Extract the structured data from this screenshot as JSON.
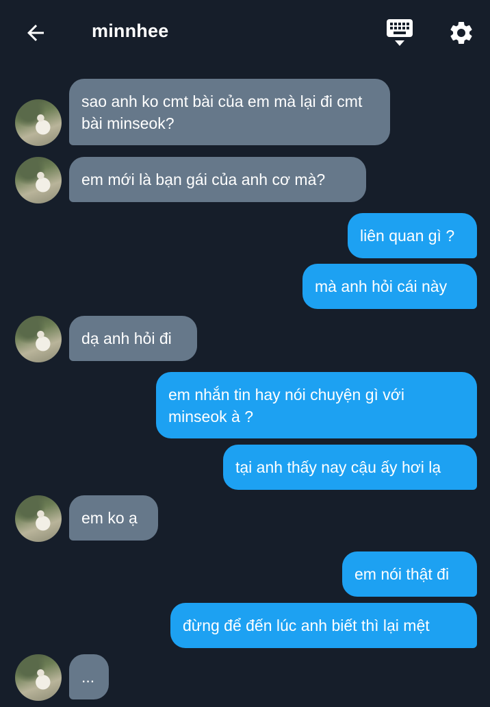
{
  "header": {
    "title": "minnhee",
    "back_icon": "back-arrow-icon",
    "keyboard_icon": "keyboard-icon",
    "settings_icon": "gear-icon"
  },
  "colors": {
    "background": "#161e2a",
    "incoming_bubble": "#66788a",
    "outgoing_bubble": "#1da1f2",
    "text": "#ffffff"
  },
  "messages": [
    {
      "side": "in",
      "text": "sao anh ko cmt bài của em mà lại đi cmt bài minseok?"
    },
    {
      "side": "in",
      "text": "em mới là bạn gái của anh cơ mà?"
    },
    {
      "side": "out",
      "text": "liên quan gì ?"
    },
    {
      "side": "out",
      "text": "mà anh hỏi cái này"
    },
    {
      "side": "in",
      "text": "dạ anh hỏi đi"
    },
    {
      "side": "out",
      "text": "em nhắn tin hay nói chuyện gì với minseok à ?"
    },
    {
      "side": "out",
      "text": "tại anh thấy nay cậu ấy hơi lạ"
    },
    {
      "side": "in",
      "text": "em ko ạ"
    },
    {
      "side": "out",
      "text": "em nói thật đi"
    },
    {
      "side": "out",
      "text": "đừng để đến lúc anh biết thì lại mệt"
    },
    {
      "side": "in",
      "text": "..."
    }
  ]
}
